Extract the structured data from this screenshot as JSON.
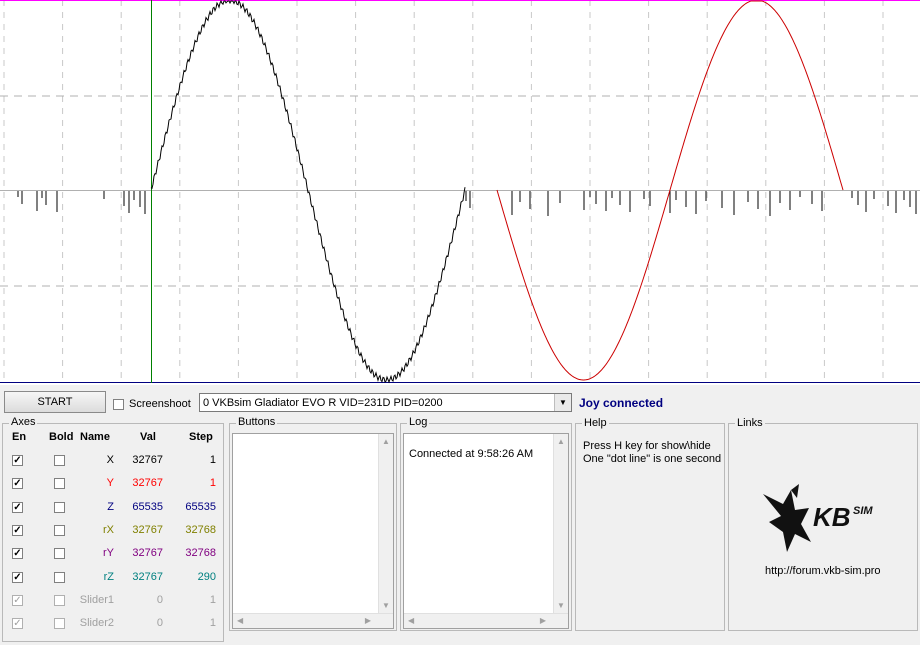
{
  "toolbar": {
    "start_label": "START",
    "screenshoot_label": "Screenshoot",
    "device_selected": "0  VKBsim Gladiator EVO  R   VID=231D PID=0200",
    "status_text": "Joy connected"
  },
  "axes": {
    "title": "Axes",
    "headers": {
      "en": "En",
      "bold": "Bold",
      "name": "Name",
      "val": "Val",
      "step": "Step"
    },
    "rows": [
      {
        "en": true,
        "bold": false,
        "name": "X",
        "val": "32767",
        "step": "1",
        "color": "#000000",
        "enabled": true
      },
      {
        "en": true,
        "bold": false,
        "name": "Y",
        "val": "32767",
        "step": "1",
        "color": "#ff0000",
        "enabled": true
      },
      {
        "en": true,
        "bold": false,
        "name": "Z",
        "val": "65535",
        "step": "65535",
        "color": "#000080",
        "enabled": true
      },
      {
        "en": true,
        "bold": false,
        "name": "rX",
        "val": "32767",
        "step": "32768",
        "color": "#808000",
        "enabled": true
      },
      {
        "en": true,
        "bold": false,
        "name": "rY",
        "val": "32767",
        "step": "32768",
        "color": "#800080",
        "enabled": true
      },
      {
        "en": true,
        "bold": false,
        "name": "rZ",
        "val": "32767",
        "step": "290",
        "color": "#008080",
        "enabled": true
      },
      {
        "en": true,
        "bold": false,
        "name": "Slider1",
        "val": "0",
        "step": "1",
        "color": "#a0a0a0",
        "enabled": false
      },
      {
        "en": true,
        "bold": false,
        "name": "Slider2",
        "val": "0",
        "step": "1",
        "color": "#a0a0a0",
        "enabled": false
      }
    ]
  },
  "buttons_panel": {
    "title": "Buttons"
  },
  "log_panel": {
    "title": "Log",
    "lines": [
      "Connected at 9:58:26 AM"
    ]
  },
  "help_panel": {
    "title": "Help",
    "lines": [
      "Press H key for show\\hide",
      "One \"dot line\" is one second"
    ]
  },
  "links_panel": {
    "title": "Links",
    "logo_text": "KB SIM",
    "url": "http://forum.vkb-sim.pro"
  },
  "colors": {
    "series_x": "#000000",
    "series_y": "#cc0000",
    "top_line": "#ff00ff",
    "marker": "#008000",
    "bottom_line": "#000080",
    "status": "#000080"
  }
}
